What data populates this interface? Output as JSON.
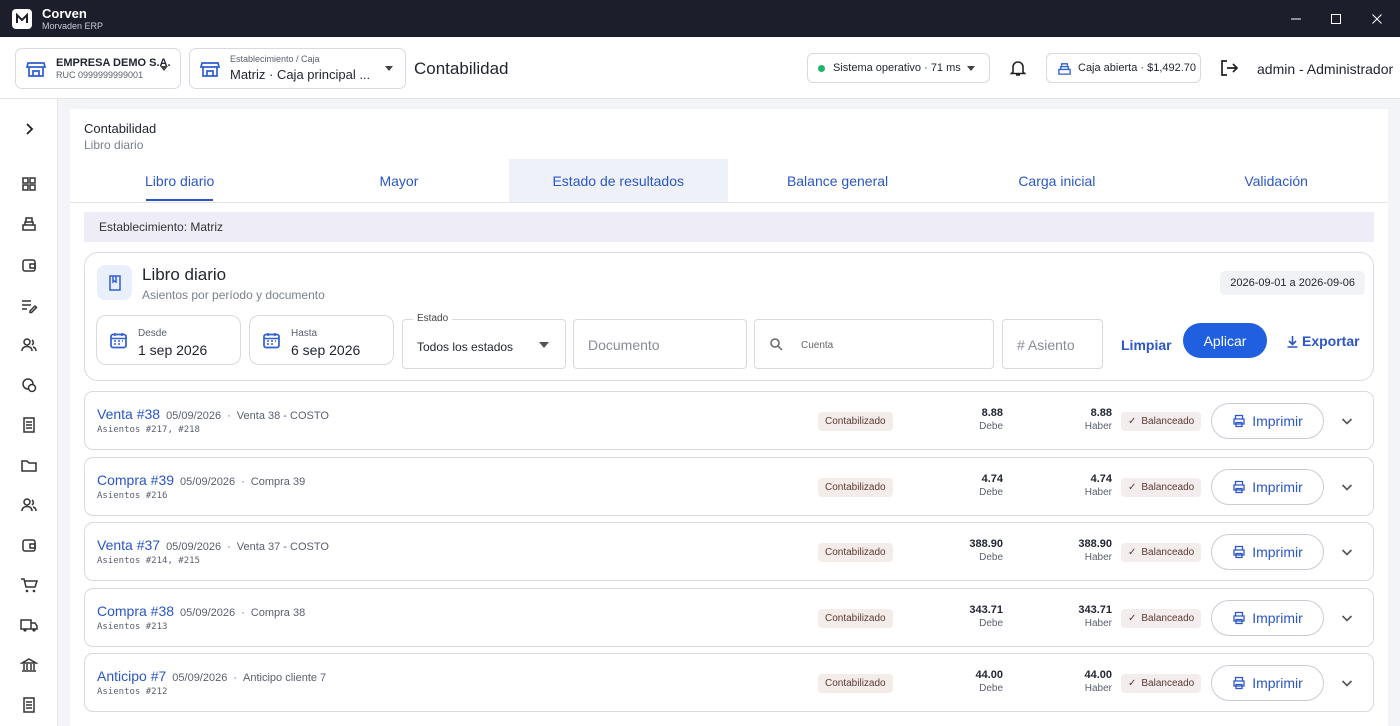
{
  "app": {
    "name": "Corven",
    "subtitle": "Morvaden ERP"
  },
  "header": {
    "company": {
      "name": "EMPRESA DEMO S.A.",
      "ruc": "RUC 0999999999001"
    },
    "establishment": {
      "label": "Establecimiento / Caja",
      "value": "Matriz · Caja principal ..."
    },
    "title": "Contabilidad",
    "system_status": "Sistema operativo · 71 ms",
    "cash_status": "Caja abierta · $1,492.70",
    "user": "admin - Administrador"
  },
  "breadcrumb": {
    "title": "Contabilidad",
    "subtitle": "Libro diario"
  },
  "tabs": [
    {
      "label": "Libro diario"
    },
    {
      "label": "Mayor"
    },
    {
      "label": "Estado de resultados"
    },
    {
      "label": "Balance general"
    },
    {
      "label": "Carga inicial"
    },
    {
      "label": "Validación"
    }
  ],
  "establishment_band": "Establecimiento: Matriz",
  "journal": {
    "title": "Libro diario",
    "subtitle": "Asientos por período y documento",
    "range": "2026-09-01 a 2026-09-06",
    "filters": {
      "from_label": "Desde",
      "from_value": "1 sep 2026",
      "to_label": "Hasta",
      "to_value": "6 sep 2026",
      "state_label": "Estado",
      "state_value": "Todos los estados",
      "document_placeholder": "Documento",
      "account_placeholder": "Cuenta",
      "entry_placeholder": "# Asiento"
    },
    "clear_label": "Limpiar",
    "apply_label": "Aplicar",
    "export_label": "Exportar"
  },
  "entries": [
    {
      "title": "Venta #38",
      "date": "05/09/2026",
      "desc": "Venta 38 - COSTO",
      "asientos": "Asientos #217, #218",
      "state": "Contabilizado",
      "debe": "8.88",
      "haber": "8.88",
      "balance": "Balanceado"
    },
    {
      "title": "Compra #39",
      "date": "05/09/2026",
      "desc": "Compra 39",
      "asientos": "Asientos #216",
      "state": "Contabilizado",
      "debe": "4.74",
      "haber": "4.74",
      "balance": "Balanceado"
    },
    {
      "title": "Venta #37",
      "date": "05/09/2026",
      "desc": "Venta 37 - COSTO",
      "asientos": "Asientos #214, #215",
      "state": "Contabilizado",
      "debe": "388.90",
      "haber": "388.90",
      "balance": "Balanceado"
    },
    {
      "title": "Compra #38",
      "date": "05/09/2026",
      "desc": "Compra 38",
      "asientos": "Asientos #213",
      "state": "Contabilizado",
      "debe": "343.71",
      "haber": "343.71",
      "balance": "Balanceado"
    },
    {
      "title": "Anticipo #7",
      "date": "05/09/2026",
      "desc": "Anticipo cliente 7",
      "asientos": "Asientos #212",
      "state": "Contabilizado",
      "debe": "44.00",
      "haber": "44.00",
      "balance": "Balanceado"
    }
  ],
  "labels": {
    "debe": "Debe",
    "haber": "Haber",
    "print": "Imprimir",
    "separator": "·"
  },
  "sidebar_icons": [
    "chevron-right-icon",
    "dashboard-icon",
    "cash-register-icon",
    "wallet-icon",
    "edit-list-icon",
    "users-icon",
    "coins-icon",
    "receipt-icon",
    "folder-icon",
    "contacts-icon",
    "wallet-alt-icon",
    "cart-icon",
    "truck-icon",
    "bank-icon",
    "ledger-icon"
  ],
  "colors": {
    "accent": "#2a56c6",
    "primary_button": "#1f5fe0",
    "titlebar": "#1c1f2b",
    "status_ok": "#1fb36b"
  }
}
